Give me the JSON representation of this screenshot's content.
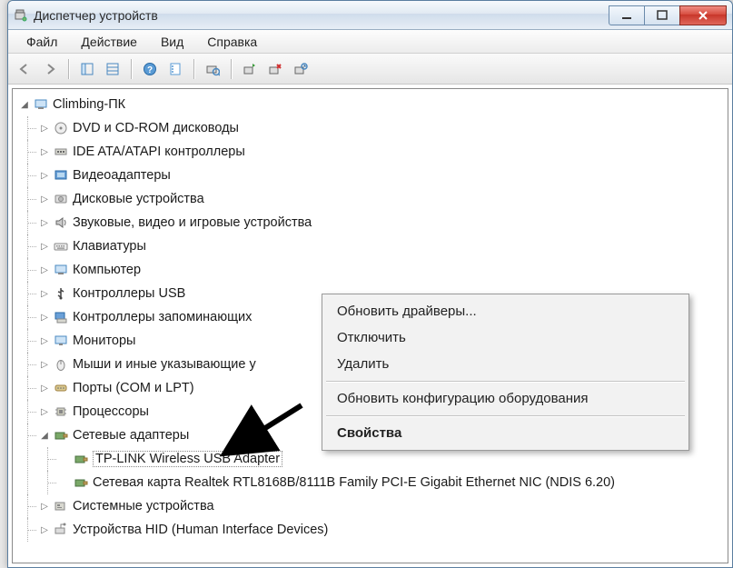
{
  "window": {
    "title": "Диспетчер устройств"
  },
  "menu": {
    "file": "Файл",
    "action": "Действие",
    "view": "Вид",
    "help": "Справка"
  },
  "tree": {
    "root": "Climbing-ПК",
    "items": [
      "DVD и CD-ROM дисководы",
      "IDE ATA/ATAPI контроллеры",
      "Видеоадаптеры",
      "Дисковые устройства",
      "Звуковые, видео и игровые устройства",
      "Клавиатуры",
      "Компьютер",
      "Контроллеры USB",
      "Контроллеры запоминающих",
      "Мониторы",
      "Мыши и иные указывающие у",
      "Порты (COM и LPT)",
      "Процессоры",
      "Сетевые адаптеры",
      "Системные устройства",
      "Устройства HID (Human Interface Devices)"
    ],
    "network_children": [
      "TP-LINK Wireless USB Adapter",
      "Сетевая карта Realtek RTL8168B/8111B Family PCI-E Gigabit Ethernet NIC (NDIS 6.20)"
    ]
  },
  "context_menu": {
    "update_drivers": "Обновить драйверы...",
    "disable": "Отключить",
    "delete": "Удалить",
    "scan_hw": "Обновить конфигурацию оборудования",
    "properties": "Свойства"
  }
}
